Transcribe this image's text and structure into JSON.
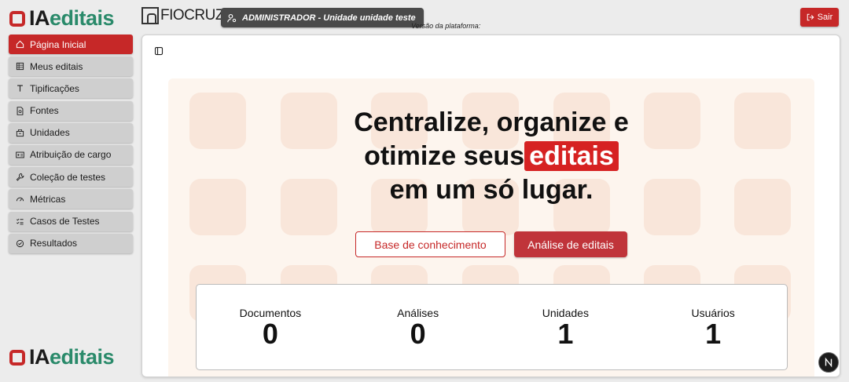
{
  "header": {
    "logo_text_a": "IA",
    "logo_text_b": "editais",
    "partner_name": "FIOCRUZ",
    "user_badge": "ADMINISTRADOR - Unidade unidade teste",
    "version_label": "Versão da plataforma:",
    "logout_label": "Sair"
  },
  "sidebar": {
    "items": [
      {
        "label": "Página Inicial",
        "icon": "home-icon",
        "active": true
      },
      {
        "label": "Meus editais",
        "icon": "table-icon"
      },
      {
        "label": "Tipificações",
        "icon": "type-icon"
      },
      {
        "label": "Fontes",
        "icon": "file-search-icon"
      },
      {
        "label": "Unidades",
        "icon": "building-icon"
      },
      {
        "label": "Atribuição de cargo",
        "icon": "id-card-icon"
      },
      {
        "label": "Coleção de testes",
        "icon": "wrench-icon"
      },
      {
        "label": "Métricas",
        "icon": "gauge-icon"
      },
      {
        "label": "Casos de Testes",
        "icon": "list-check-icon"
      },
      {
        "label": "Resultados",
        "icon": "check-circle-icon"
      }
    ]
  },
  "hero": {
    "line1": "Centralize, organize e",
    "line2_before": "otimize seus",
    "line2_highlight": "editais",
    "line3": "em um só lugar.",
    "btn_knowledge": "Base de conhecimento",
    "btn_analysis": "Análise de editais"
  },
  "stats": [
    {
      "label": "Documentos",
      "value": "0"
    },
    {
      "label": "Análises",
      "value": "0"
    },
    {
      "label": "Unidades",
      "value": "1"
    },
    {
      "label": "Usuários",
      "value": "1"
    }
  ],
  "colors": {
    "accent": "#c62828",
    "sidebar_bg": "#cfcfcf",
    "hero_bg": "#fdf5ee"
  }
}
